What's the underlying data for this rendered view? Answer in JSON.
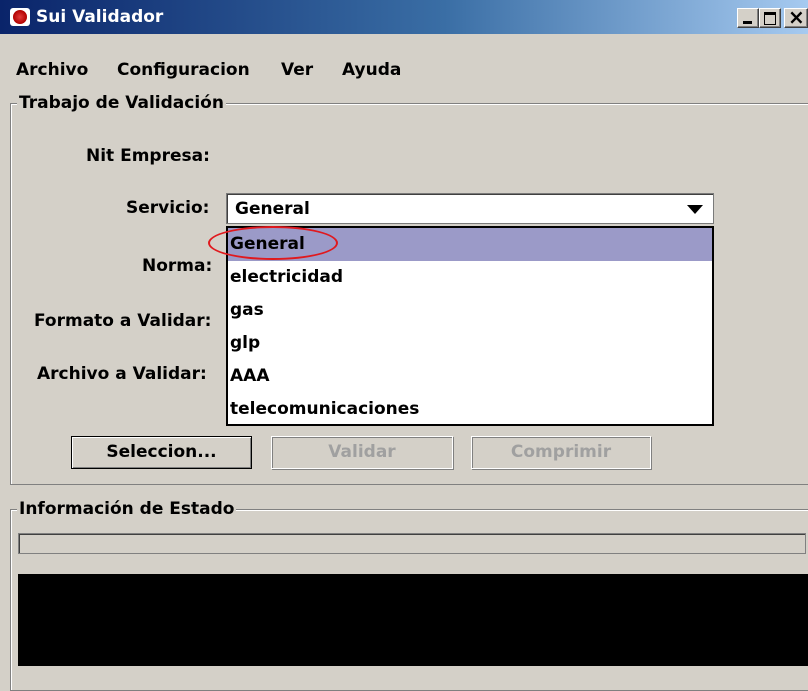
{
  "window": {
    "title": "Sui Validador"
  },
  "menu": [
    "Archivo",
    "Configuracion",
    "Ver",
    "Ayuda"
  ],
  "trabajo": {
    "title": "Trabajo de Validación",
    "labels": {
      "nit": "Nit Empresa:",
      "servicio": "Servicio:",
      "norma": "Norma:",
      "formato": "Formato a Validar:",
      "archivo": "Archivo a Validar:"
    },
    "servicio": {
      "selected": "General",
      "options": [
        "General",
        "electricidad",
        "gas",
        "glp",
        "AAA",
        "telecomunicaciones"
      ]
    },
    "buttons": {
      "seleccion": "Seleccion...",
      "validar": "Validar",
      "comprimir": "Comprimir"
    }
  },
  "estado": {
    "title": "Información de Estado",
    "progress": 0
  },
  "colors": {
    "selection": "#9b9ac8",
    "annotation": "#e0191e",
    "titlebar": "#0a246a"
  }
}
